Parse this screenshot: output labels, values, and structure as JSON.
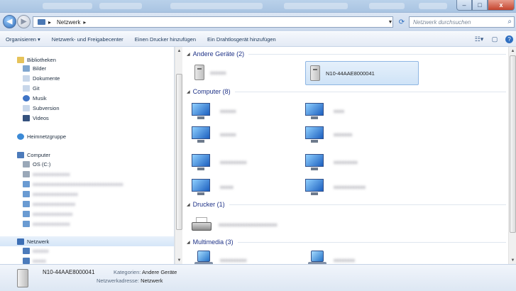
{
  "titlebar": {
    "min": "–",
    "max": "□",
    "close": "x"
  },
  "address": {
    "crumb": "Netzwerk",
    "arrow": "▸",
    "search_placeholder": "Netzwerk durchsuchen"
  },
  "toolbar": {
    "organize": "Organisieren ▾",
    "network_center": "Netzwerk- und Freigabecenter",
    "add_printer": "Einen Drucker hinzufügen",
    "add_wireless": "Ein Drahtlosgerät hinzufügen"
  },
  "nav": {
    "libraries": "Bibliotheken",
    "lib_items": [
      "Bilder",
      "Dokumente",
      "Git",
      "Musik",
      "Subversion",
      "Videos"
    ],
    "homegroup": "Heimnetzgruppe",
    "computer": "Computer",
    "os_drive": "OS (C:)",
    "network": "Netzwerk"
  },
  "groups": {
    "other": "Andere Geräte (2)",
    "computer": "Computer (8)",
    "printer": "Drucker (1)",
    "multimedia": "Multimedia (3)"
  },
  "tiles": {
    "selected_device": "N10-44AAE8000041"
  },
  "details": {
    "name": "N10-44AAE8000041",
    "cat_key": "Kategorien:",
    "cat_val": "Andere Geräte",
    "addr_key": "Netzwerkadresse:",
    "addr_val": "Netzwerk"
  }
}
